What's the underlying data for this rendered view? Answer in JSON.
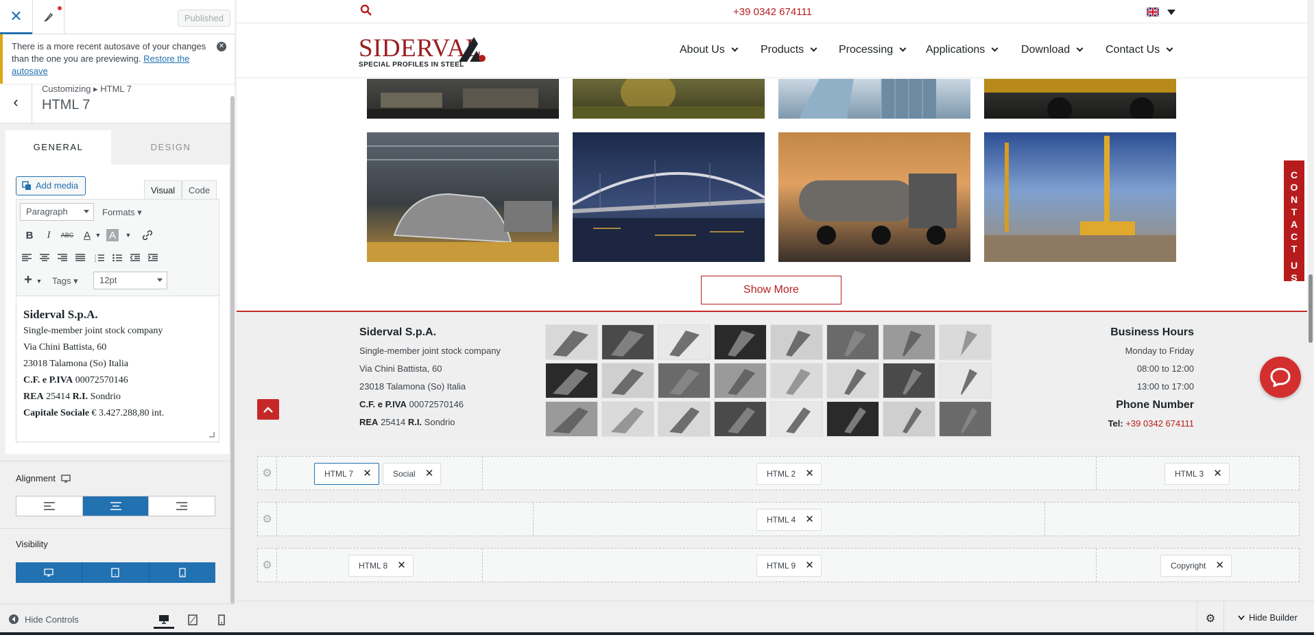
{
  "panel": {
    "published_label": "Published",
    "notice_text": "There is a more recent autosave of your changes than the one you are previewing.",
    "notice_link": "Restore the autosave",
    "breadcrumb": "Customizing ▸ HTML 7",
    "section_title": "HTML 7",
    "tabs": [
      "GENERAL",
      "DESIGN"
    ],
    "add_media_label": "Add media",
    "editor_tabs": [
      "Visual",
      "Code"
    ],
    "format_select": "Paragraph",
    "formats_label": "Formats",
    "tags_label": "Tags",
    "size_select": "12pt",
    "content": {
      "name": "Siderval S.p.A.",
      "line1": "Single-member joint stock company",
      "line2": "Via Chini Battista, 60",
      "line3": "23018 Talamona (So) Italia",
      "line4_label": "C.F. e P.IVA",
      "line4_value": " 00072570146",
      "line5_label": "REA",
      "line5_value": " 25414 ",
      "line5_label2": "R.I.",
      "line5_value2": " Sondrio",
      "line6_label": "Capitale Sociale",
      "line6_value": " € 3.427.288,80 int."
    },
    "alignment_label": "Alignment",
    "visibility_label": "Visibility",
    "hide_controls_label": "Hide Controls"
  },
  "site": {
    "phone": "+39 0342 674111",
    "logo_word": "SIDERVAL",
    "logo_tag": "SPECIAL PROFILES IN STEEL",
    "menu": [
      "About Us",
      "Products",
      "Processing",
      "Applications",
      "Download",
      "Contact Us"
    ],
    "show_more": "Show More",
    "contact_tab": "CONTACT US",
    "footer": {
      "company": "Siderval S.p.A.",
      "line1": "Single-member joint stock company",
      "line2": "Via Chini Battista, 60",
      "line3": "23018 Talamona (So) Italia",
      "cf_label": "C.F. e P.IVA",
      "cf_value": " 00072570146",
      "rea_label": "REA",
      "rea_value": " 25414 ",
      "ri_label": "R.I.",
      "ri_value": " Sondrio",
      "hours_title": "Business Hours",
      "hours_days": "Monday to Friday",
      "hours_am": "08:00 to 12:00",
      "hours_pm": "13:00 to 17:00",
      "phone_title": "Phone Number",
      "tel_label": "Tel:",
      "tel_value": "+39 0342 674111"
    }
  },
  "builder": {
    "row1": [
      "HTML 7",
      "Social",
      "HTML 2",
      "HTML 3"
    ],
    "row2": [
      "HTML 4"
    ],
    "row3": [
      "HTML 8",
      "HTML 9",
      "Copyright"
    ],
    "hide_builder_label": "Hide Builder"
  },
  "colors": {
    "wp_blue": "#2271b1",
    "brand_red": "#b71c1c",
    "notice_yellow": "#dba617"
  }
}
